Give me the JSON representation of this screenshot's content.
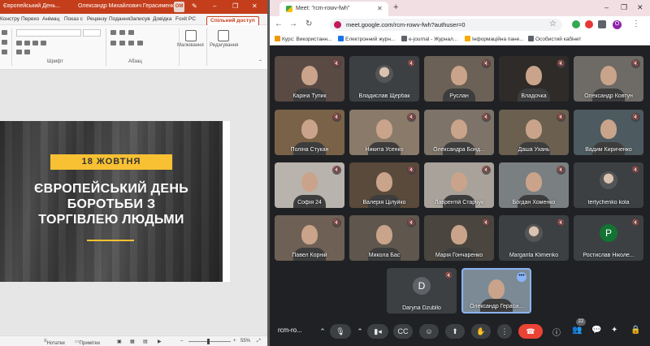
{
  "powerpoint": {
    "title_left": "Європейський День...",
    "user_name": "Олександр Михайлович Герасименко",
    "user_initials": "ОМ",
    "tabs": [
      "Констру",
      "Перехо",
      "Анімац",
      "Показ с",
      "Рецензу",
      "Подання",
      "Записув",
      "Довідка",
      "Foxit PC"
    ],
    "share_label": "Спільний доступ",
    "ribbon": {
      "font_group": "Шрифт",
      "paragraph_group": "Абзац",
      "drawing_label": "Малювання",
      "editing_label": "Редагування"
    },
    "slide": {
      "date": "18 ЖОВТНЯ",
      "heading_lines": [
        "ЄВРОПЕЙСЬКИЙ ДЕНЬ",
        "БОРОТЬБИ З",
        "ТОРГІВЛЕЮ ЛЮДЬМИ"
      ]
    },
    "status": {
      "notes": "Нотатки",
      "comments": "Примітки",
      "zoom": "55%"
    }
  },
  "chrome": {
    "tab_title": "Meet: \"rcm-rowv-fwh\"",
    "url": "meet.google.com/rcm-rowv-fwh?authuser=0",
    "profile_initial": "O",
    "bookmarks": [
      {
        "label": "Курс: Використанн...",
        "color": "#f29900"
      },
      {
        "label": "Електронний журн...",
        "color": "#1a73e8"
      },
      {
        "label": "e-journal - Журнал...",
        "color": "#5f6368"
      },
      {
        "label": "Інформаційна пане...",
        "color": "#f9ab00"
      },
      {
        "label": "Особистий кабінет",
        "color": "#5f6368"
      }
    ]
  },
  "meet": {
    "participants": [
      {
        "name": "Каріна Тупик",
        "bg": "#5a4a44"
      },
      {
        "name": "Владислав Щербак",
        "bg": "#3c4043",
        "avatar_photo": true
      },
      {
        "name": "Руслан",
        "bg": "#6b6157"
      },
      {
        "name": "Владочка",
        "bg": "#2e2b29"
      },
      {
        "name": "Олександр Ковтун",
        "bg": "#6e6a66"
      },
      {
        "name": "Поліна Стукан",
        "bg": "#7a6248"
      },
      {
        "name": "Никита Усенко",
        "bg": "#8a7a6a"
      },
      {
        "name": "Олександра Бонд...",
        "bg": "#7d7368"
      },
      {
        "name": "Даша Ухань",
        "bg": "#6b5f50"
      },
      {
        "name": "Вадим Кириченко",
        "bg": "#4d5a5f"
      },
      {
        "name": "Софія 24",
        "bg": "#b9b3ad"
      },
      {
        "name": "Валерія Цілуйко",
        "bg": "#5a4a3c"
      },
      {
        "name": "Лаврентій Старчук",
        "bg": "#a8a29a"
      },
      {
        "name": "Богдан Хоменко",
        "bg": "#7a7f82"
      },
      {
        "name": "tertychenko kola",
        "bg": "#3c4043",
        "avatar_photo": true
      },
      {
        "name": "Павел Корній",
        "bg": "#6e6055"
      },
      {
        "name": "Микола Бас",
        "bg": "#5f574e"
      },
      {
        "name": "Марія Гончаренко",
        "bg": "#4a463f"
      },
      {
        "name": "Margarita Klimenko",
        "bg": "#3c4043",
        "avatar_photo": true
      },
      {
        "name": "Ростислав Ніколе...",
        "bg": "#3c4043",
        "letter": "Р",
        "letter_color": "#137333"
      },
      {
        "name": "Daryna Dzubllo",
        "bg": "#3c4043",
        "letter": "D",
        "letter_color": "#5f6368"
      },
      {
        "name": "Олександр Гераси...",
        "bg": "#7c8a96"
      }
    ],
    "meeting_code": "rcm-ro...",
    "participant_count": "22"
  }
}
